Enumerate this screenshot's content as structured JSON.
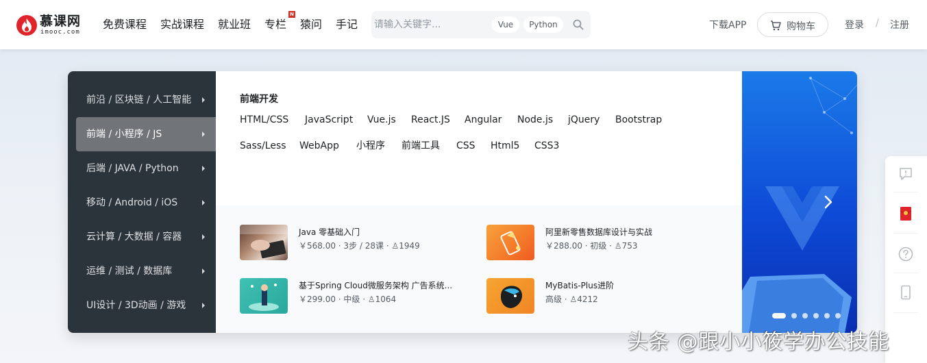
{
  "header": {
    "logo_name": "慕课网",
    "logo_domain": "imooc.com",
    "nav": [
      "免费课程",
      "实战课程",
      "就业班",
      "专栏",
      "猿问",
      "手记"
    ],
    "nav_badge": "N",
    "search_placeholder": "请输入关键字...",
    "search_tags": [
      "Vue",
      "Python"
    ],
    "download_app": "下载APP",
    "cart": "购物车",
    "login": "登录",
    "separator": "/",
    "register": "注册"
  },
  "sidebar": {
    "items": [
      {
        "label": "前沿 / 区块链 / 人工智能"
      },
      {
        "label": "前端 / 小程序 / JS"
      },
      {
        "label": "后端 / JAVA / Python"
      },
      {
        "label": "移动 / Android / iOS"
      },
      {
        "label": "云计算 / 大数据 / 容器"
      },
      {
        "label": "运维 / 测试 / 数据库"
      },
      {
        "label": "UI设计 / 3D动画 / 游戏"
      }
    ]
  },
  "panel": {
    "title": "前端开发",
    "row1": [
      "HTML/CSS",
      "JavaScript",
      "Vue.js",
      "React.JS",
      "Angular",
      "Node.js",
      "jQuery",
      "Bootstrap"
    ],
    "row2": [
      "Sass/Less",
      "WebApp",
      "小程序",
      "前端工具",
      "CSS",
      "Html5",
      "CSS3"
    ]
  },
  "courses": [
    {
      "title": "Java 零基础入门",
      "meta": "￥568.00 · 3步 / 28课 · ♙1949"
    },
    {
      "title": "阿里新零售数据库设计与实战",
      "meta": "￥288.00 · 初级 · ♙753"
    },
    {
      "title": "基于Spring Cloud微服务架构 广告系统...",
      "meta": "￥299.00 · 中级 · ♙1064"
    },
    {
      "title": "MyBatis-Plus进阶",
      "meta": "高级 · ♙4212"
    }
  ],
  "icons": {
    "search": "search-icon",
    "cart": "cart-icon",
    "next": "chevron-right-icon",
    "feedback": "feedback-icon",
    "redpacket": "red-packet-icon",
    "help": "help-icon",
    "mobile": "mobile-icon"
  },
  "colors": {
    "brand_red": "#e0242b",
    "sidebar_bg": "#2b333b",
    "sidebar_active": "#717579",
    "banner_blue": "#0d4ad6"
  },
  "watermark": "头条 @跟小小筱学办公技能"
}
